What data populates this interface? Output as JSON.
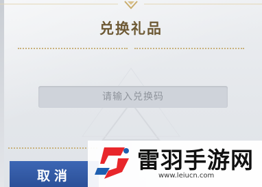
{
  "dialog": {
    "title": "兑换礼品",
    "code_input": {
      "placeholder": "请输入兑换码",
      "value": ""
    },
    "cancel_label": "取消"
  },
  "watermark": {
    "site_name": "雷羽手游网",
    "site_url": "www.leiucn.com"
  },
  "colors": {
    "title": "#6e5a35",
    "ornament_gold": "#c8b07a",
    "cancel_button": "#2f56a2",
    "logo_red": "#e8262b",
    "logo_blue": "#1e5fb0"
  },
  "icons": {
    "logo": "leiyu-logo-icon",
    "ornament": "gold-ornament-icon"
  }
}
